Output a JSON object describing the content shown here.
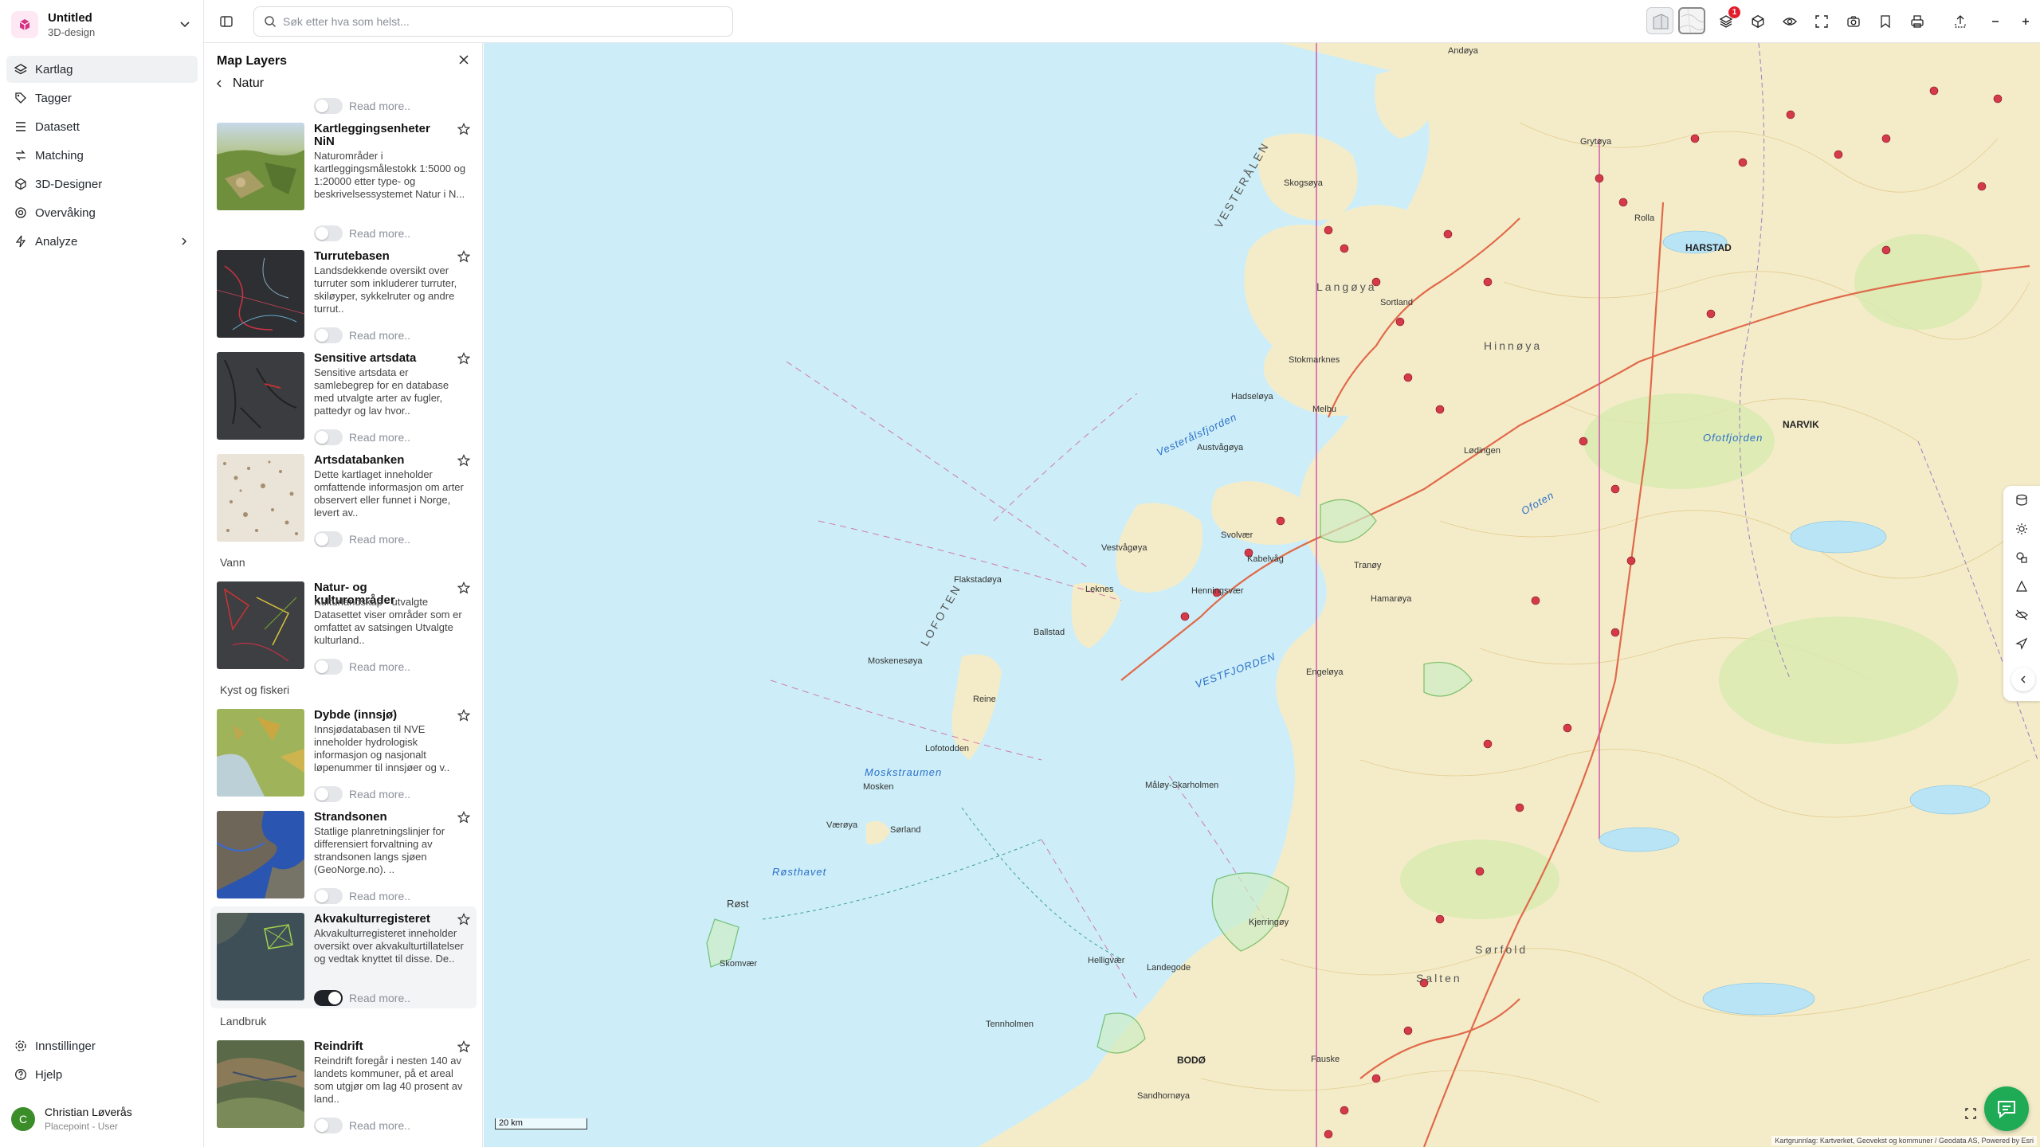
{
  "project": {
    "name": "Untitled",
    "type": "3D-design"
  },
  "nav": {
    "items": [
      {
        "label": "Kartlag",
        "icon": "layers-icon"
      },
      {
        "label": "Tagger",
        "icon": "tag-icon"
      },
      {
        "label": "Datasett",
        "icon": "list-icon"
      },
      {
        "label": "Matching",
        "icon": "matching-icon"
      },
      {
        "label": "3D-Designer",
        "icon": "cube-icon"
      },
      {
        "label": "Overvåking",
        "icon": "radar-icon"
      },
      {
        "label": "Analyze",
        "icon": "bolt-icon"
      }
    ],
    "bottom": [
      {
        "label": "Innstillinger",
        "icon": "gear-icon"
      },
      {
        "label": "Hjelp",
        "icon": "help-icon"
      }
    ]
  },
  "user": {
    "initial": "C",
    "name": "Christian Løverås",
    "role": "Placepoint - User"
  },
  "search": {
    "placeholder": "Søk etter hva som helst..."
  },
  "toolbar": {
    "notification_count": "1",
    "accent": "#e11d2c"
  },
  "layers_panel": {
    "title": "Map Layers",
    "breadcrumb": "Natur",
    "read_more": "Read more..",
    "cards": [
      {
        "title": "Kartleggingsenheter NiN",
        "desc": "Naturområder i kartleggingsmålestokk 1:5000 og 1:20000 etter type- og beskrivelsessystemet Natur i N...",
        "enabled": false
      },
      {
        "title": "Turrutebasen",
        "desc": "Landsdekkende oversikt over turruter som inkluderer turruter, skiløyper, sykkelruter og andre turrut..",
        "enabled": false
      },
      {
        "title": "Sensitive artsdata",
        "desc": "Sensitive artsdata er samlebegrep for en database med utvalgte arter av fugler, pattedyr og lav hvor..",
        "enabled": false
      },
      {
        "title": "Artsdatabanken",
        "desc": "Dette kartlaget inneholder omfattende informasjon om arter observert eller funnet i Norge, levert av..",
        "enabled": false
      },
      {
        "title": "Natur- og kulturområder",
        "desc": "Kulturlandskap - utvalgte Datasettet viser områder som er omfattet av satsingen Utvalgte kulturland..",
        "enabled": false
      },
      {
        "title": "Dybde (innsjø)",
        "desc": "Innsjødatabasen til NVE inneholder hydrologisk informasjon og nasjonalt løpenummer til innsjøer og v..",
        "enabled": false
      },
      {
        "title": "Strandsonen",
        "desc": "Statlige planretningslinjer for differensiert forvaltning av strandsonen langs sjøen (GeoNorge.no). ..",
        "enabled": false
      },
      {
        "title": "Akvakulturregisteret",
        "desc": "Akvakulturregisteret inneholder oversikt over akvakulturtillatelser og vedtak knyttet til disse. De..",
        "enabled": true
      },
      {
        "title": "Reindrift",
        "desc": "Reindrift foregår i nesten 140 av landets kommuner, på et areal som utgjør om lag 40 prosent av land..",
        "enabled": false
      }
    ],
    "sections": {
      "vann": "Vann",
      "kyst": "Kyst og fiskeri",
      "landbruk": "Landbruk"
    }
  },
  "map": {
    "scale_label": "20 km",
    "attribution": "Kartgrunnlag: Kartverket, Geovekst og kommuner / Geodata AS, Powered by Esri",
    "places": {
      "andoya": "Andøya",
      "vesteralen": "VESTERÅLEN",
      "langoya": "Langøya",
      "hinnoya": "Hinnøya",
      "harstad": "HARSTAD",
      "narvik": "NARVIK",
      "lofoten": "LOFOTEN",
      "ofoten": "Ofoten",
      "vestfjorden": "VESTFJORDEN",
      "rosthavet": "Røsthavet",
      "rost": "Røst",
      "vaeroya": "Værøya",
      "moskenesoya": "Moskenesøya",
      "flakstadoya": "Flakstadøya",
      "vestvagoy": "Vestvågøya",
      "austvagoy": "Austvågøya",
      "hadseloya": "Hadseløya",
      "hamaroy": "Hamarøya",
      "engeloya": "Engeløya",
      "salten": "Salten",
      "sorfold": "Sørfold",
      "bodo": "BODØ",
      "fauske": "Fauske",
      "svolvaer": "Svolvær",
      "leknes": "Leknes",
      "sortland": "Sortland",
      "stokmarknes": "Stokmarknes",
      "lodingen": "Lødingen",
      "moskstraumen": "Moskstraumen",
      "kabelvag": "Kabelvåg",
      "henningsvaer": "Henningsvær",
      "reine": "Reine",
      "ballstad": "Ballstad",
      "melbu": "Melbu",
      "vesteralsfjorden": "Vesterålsfjorden",
      "ofotfjorden": "Ofotfjorden",
      "helligvaer": "Helligvær",
      "sandhornoy": "Sandhornøya",
      "landegode": "Landegode",
      "tranoy": "Tranøy",
      "skogsoya": "Skogsøya",
      "gryotya": "Grytøya",
      "rolla": "Rolla",
      "kjerringoy": "Kjerringøy",
      "maloy": "Måløy-Skarholmen",
      "tennholmen": "Tennholmen",
      "skomvaer": "Skomvær",
      "sorland": "Sørland",
      "lofotodden": "Lofotodden",
      "mosken": "Mosken"
    }
  }
}
